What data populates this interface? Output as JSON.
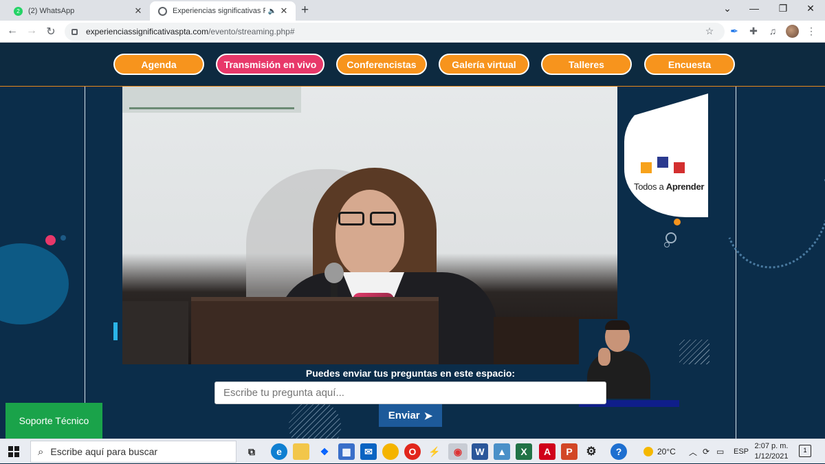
{
  "browser": {
    "tabs": [
      {
        "title": "(2) WhatsApp",
        "badge": "2",
        "favicon_color": "#25d366",
        "active": false
      },
      {
        "title": "Experiencias significativas PT",
        "favicon_color": "#5f6368",
        "active": true
      }
    ],
    "url_domain": "experienciassignificativaspta.com",
    "url_path": "/evento/streaming.php#"
  },
  "nav": {
    "items": [
      "Agenda",
      "Transmisión en vivo",
      "Conferencistas",
      "Galería virtual",
      "Talleres",
      "Encuesta"
    ],
    "active_index": 1,
    "accent": "#f7941d",
    "active_color": "#e8386a"
  },
  "stream": {
    "logo_text_light": "Todos a ",
    "logo_text_bold": "Aprender"
  },
  "questions": {
    "label": "Puedes enviar tus preguntas en este espacio:",
    "placeholder": "Escribe tu pregunta aquí...",
    "send_label": "Enviar"
  },
  "support": {
    "label": "Soporte Técnico"
  },
  "taskbar": {
    "search_placeholder": "Escribe aquí para buscar",
    "weather": "20°C",
    "language": "ESP",
    "time": "2:07 p. m.",
    "date": "1/12/2021",
    "notifications": "1"
  }
}
